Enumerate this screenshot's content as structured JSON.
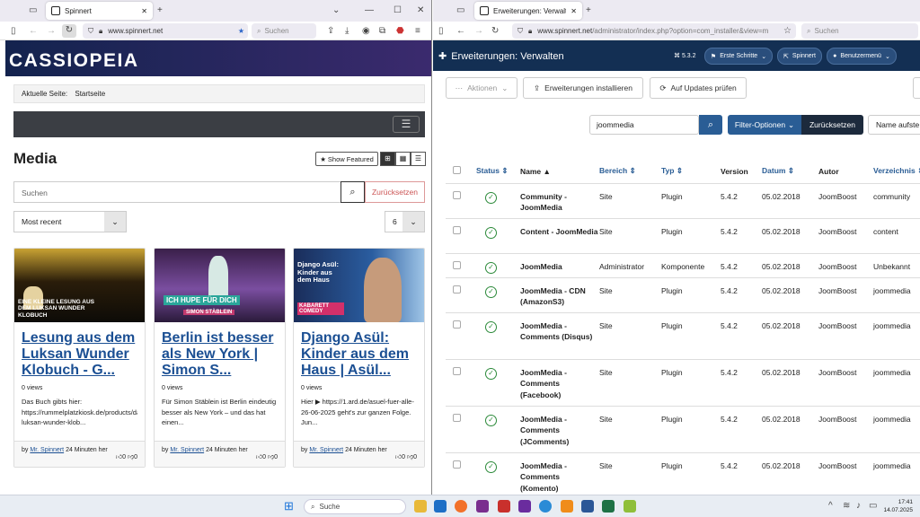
{
  "left_browser": {
    "tab_title": "Spinnert",
    "url": "www.spinnert.net",
    "search_placeholder": "Suchen"
  },
  "site": {
    "logo": "CASSIOPEIA",
    "breadcrumb_label": "Aktuelle Seite:",
    "breadcrumb_current": "Startseite",
    "page_title": "Media",
    "show_featured": "Show Featured",
    "search_placeholder": "Suchen",
    "reset_label": "Zurücksetzen",
    "sort_value": "Most recent",
    "per_page": "6",
    "cards": [
      {
        "title": "Lesung aus dem Luksan Wunder Klobuch - G...",
        "views": "0 views",
        "desc": "Das Buch gibts hier: https://rummelplatzkiosk.de/products/das-luksan-wunder-klob...",
        "by": "by",
        "author": "Mr. Spinnert",
        "time": "24 Minuten her",
        "likes": "0",
        "dislikes": "0",
        "thumb_text": "EINE KLEINE LESUNG AUS DEM LUKSAN WUNDER KLOBUCH"
      },
      {
        "title": "Berlin ist besser als New York | Simon S...",
        "views": "0 views",
        "desc": "Für Simon Stäblein ist Berlin eindeutig besser als New York – und das hat einen...",
        "by": "by",
        "author": "Mr. Spinnert",
        "time": "24 Minuten her",
        "likes": "0",
        "dislikes": "0",
        "thumb_text": "ICH HUPE FÜR DICH",
        "thumb_sub": "SIMON STÄBLEIN"
      },
      {
        "title": "Django Asül: Kinder aus dem Haus | Asül...",
        "views": "0 views",
        "desc": "Hier ▶ https://1.ard.de/asuel-fuer-alle-26-06-2025 geht's zur ganzen Folge. Jun...",
        "by": "by",
        "author": "Mr. Spinnert",
        "time": "24 Minuten her",
        "likes": "0",
        "dislikes": "0",
        "thumb_text": "Django Asül: Kinder aus dem Haus",
        "thumb_sub": "KABARETT COMEDY"
      }
    ]
  },
  "right_browser": {
    "tab_title": "Erweiterungen: Verwalten - Spi",
    "url_host": "www.spinnert.net",
    "url_path": "/administrator/index.php?option=com_installer&view=m",
    "search_placeholder": "Suchen"
  },
  "admin": {
    "title": "Erweiterungen: Verwalten",
    "version": "5.3.2",
    "pills": [
      "Erste Schritte",
      "Spinnert",
      "Benutzermenü"
    ],
    "actions_label": "Aktionen",
    "install_label": "Erweiterungen installieren",
    "updates_label": "Auf Updates prüfen",
    "search_value": "joommedia",
    "filter_label": "Filter-Optionen",
    "reset_label": "Zurücksetzen",
    "sort_label": "Name aufste",
    "columns": [
      "Status",
      "Name",
      "Bereich",
      "Typ",
      "Version",
      "Datum",
      "Autor",
      "Verzeichnis"
    ],
    "rows": [
      {
        "name": "Community - JoomMedia",
        "area": "Site",
        "type": "Plugin",
        "version": "5.4.2",
        "date": "05.02.2018",
        "author": "JoomBoost",
        "folder": "community"
      },
      {
        "name": "Content - JoomMedia",
        "area": "Site",
        "type": "Plugin",
        "version": "5.4.2",
        "date": "05.02.2018",
        "author": "JoomBoost",
        "folder": "content"
      },
      {
        "name": "JoomMedia",
        "area": "Administrator",
        "type": "Komponente",
        "version": "5.4.2",
        "date": "05.02.2018",
        "author": "JoomBoost",
        "folder": "Unbekannt"
      },
      {
        "name": "JoomMedia - CDN (AmazonS3)",
        "area": "Site",
        "type": "Plugin",
        "version": "5.4.2",
        "date": "05.02.2018",
        "author": "JoomBoost",
        "folder": "joommedia"
      },
      {
        "name": "JoomMedia - Comments (Disqus)",
        "area": "Site",
        "type": "Plugin",
        "version": "5.4.2",
        "date": "05.02.2018",
        "author": "JoomBoost",
        "folder": "joommedia"
      },
      {
        "name": "JoomMedia - Comments (Facebook)",
        "area": "Site",
        "type": "Plugin",
        "version": "5.4.2",
        "date": "05.02.2018",
        "author": "JoomBoost",
        "folder": "joommedia"
      },
      {
        "name": "JoomMedia - Comments (JComments)",
        "area": "Site",
        "type": "Plugin",
        "version": "5.4.2",
        "date": "05.02.2018",
        "author": "JoomBoost",
        "folder": "joommedia"
      },
      {
        "name": "JoomMedia - Comments (Komento)",
        "area": "Site",
        "type": "Plugin",
        "version": "5.4.2",
        "date": "05.02.2018",
        "author": "JoomBoost",
        "folder": "joommedia"
      }
    ]
  },
  "taskbar": {
    "search_label": "Suche",
    "time": "17:41",
    "date": "14.07.2025"
  }
}
